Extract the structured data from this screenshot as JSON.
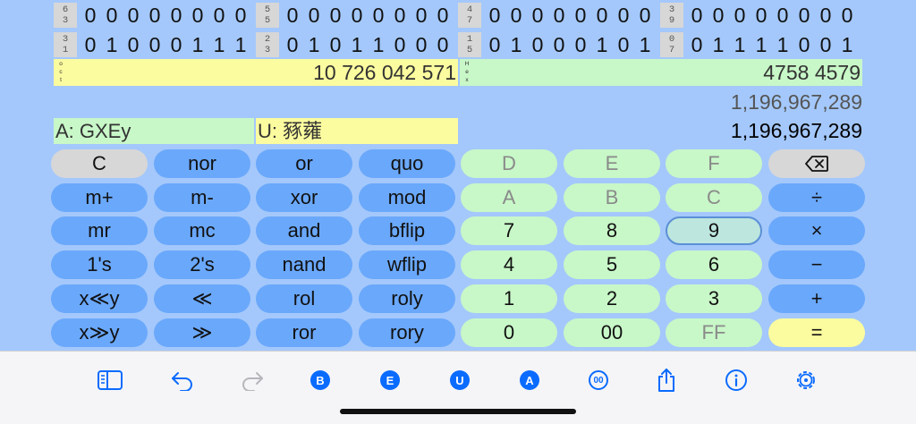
{
  "bits": {
    "row1": [
      {
        "pos": [
          "6",
          "3"
        ],
        "bits": [
          "0",
          "0",
          "0",
          "0",
          "0",
          "0",
          "0",
          "0"
        ]
      },
      {
        "pos": [
          "5",
          "5"
        ],
        "bits": [
          "0",
          "0",
          "0",
          "0",
          "0",
          "0",
          "0",
          "0"
        ]
      },
      {
        "pos": [
          "4",
          "7"
        ],
        "bits": [
          "0",
          "0",
          "0",
          "0",
          "0",
          "0",
          "0",
          "0"
        ]
      },
      {
        "pos": [
          "3",
          "9"
        ],
        "bits": [
          "0",
          "0",
          "0",
          "0",
          "0",
          "0",
          "0",
          "0"
        ]
      }
    ],
    "row2": [
      {
        "pos": [
          "3",
          "1"
        ],
        "bits": [
          "0",
          "1",
          "0",
          "0",
          "0",
          "1",
          "1",
          "1"
        ]
      },
      {
        "pos": [
          "2",
          "3"
        ],
        "bits": [
          "0",
          "1",
          "0",
          "1",
          "1",
          "0",
          "0",
          "0"
        ]
      },
      {
        "pos": [
          "1",
          "5"
        ],
        "bits": [
          "0",
          "1",
          "0",
          "0",
          "0",
          "1",
          "0",
          "1"
        ]
      },
      {
        "pos": [
          "0",
          "7"
        ],
        "bits": [
          "0",
          "1",
          "1",
          "1",
          "1",
          "0",
          "0",
          "1"
        ]
      }
    ]
  },
  "oct": {
    "tag": [
      "o",
      "c",
      "t"
    ],
    "value": "10 726 042 571"
  },
  "hex": {
    "tag": [
      "H",
      "e",
      "x"
    ],
    "value": "4758 4579"
  },
  "decimal_secondary": "1,196,967,289",
  "decimal_main": "1,196,967,289",
  "ascii": "A: GXEy",
  "unicode": "U: 豩蕹",
  "colors": {
    "background": "#a4c8fb",
    "blue_key": "#6aa8fb",
    "green_key": "#c8f7c8",
    "yellow": "#fbfb9f",
    "gray_key": "#d7d7d7",
    "toolbar_icon": "#0a6bff"
  },
  "keys": {
    "c": "C",
    "nor": "nor",
    "or": "or",
    "quo": "quo",
    "d": "D",
    "e": "E",
    "f": "F",
    "backspace": "⌫",
    "mplus": "m+",
    "mminus": "m-",
    "xor": "xor",
    "mod": "mod",
    "a": "A",
    "b": "B",
    "chex": "C",
    "divide": "÷",
    "mr": "mr",
    "mc": "mc",
    "and": "and",
    "bflip": "bflip",
    "n7": "7",
    "n8": "8",
    "n9": "9",
    "multiply": "×",
    "ones": "1's",
    "twos": "2's",
    "nand": "nand",
    "wflip": "wflip",
    "n4": "4",
    "n5": "5",
    "n6": "6",
    "minus": "−",
    "xshly": "x≪y",
    "shl": "≪",
    "rol": "rol",
    "roly": "roly",
    "n1": "1",
    "n2": "2",
    "n3": "3",
    "plus": "+",
    "xshry": "x≫y",
    "shr": "≫",
    "ror": "ror",
    "rory": "rory",
    "n0": "0",
    "n00": "00",
    "ff": "FF",
    "equals": "="
  },
  "toolbar": {
    "sidebar_icon": "sidebar-icon",
    "undo_icon": "undo-icon",
    "redo_icon": "redo-icon",
    "b": "B",
    "e": "E",
    "u": "U",
    "a": "A",
    "oo": "00",
    "share_icon": "share-icon",
    "info_icon": "info-icon",
    "settings_icon": "gear-icon"
  }
}
